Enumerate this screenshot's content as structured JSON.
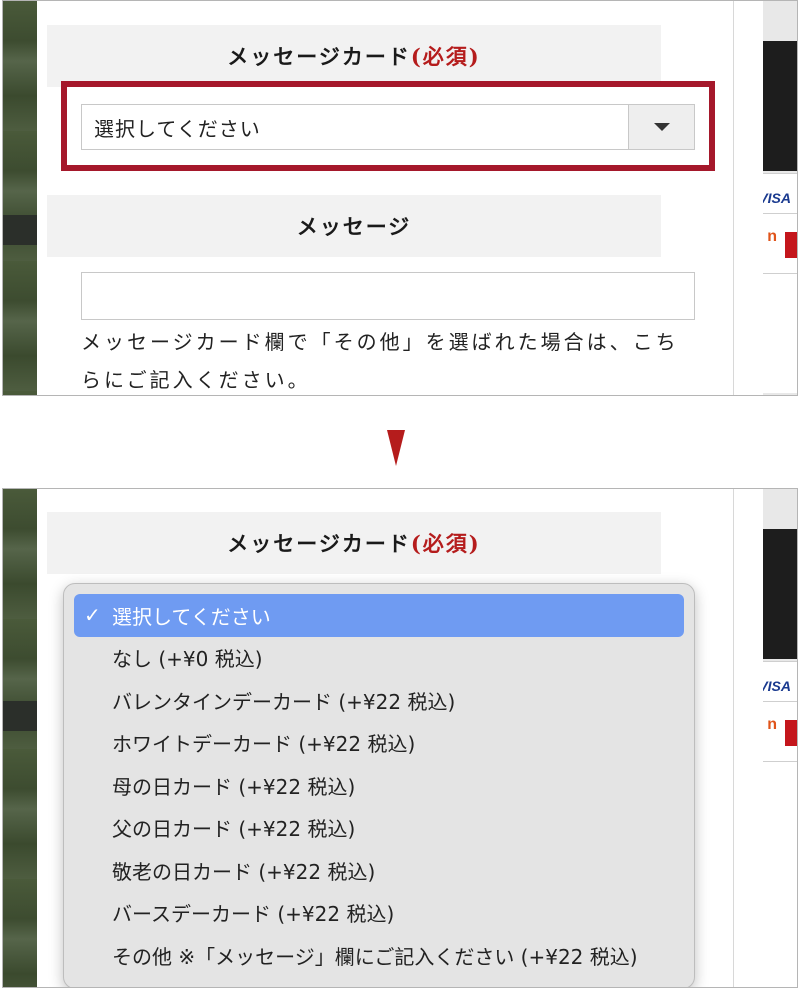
{
  "top_panel": {
    "message_card_section": {
      "title": "メッセージカード",
      "required_label": "(必須)"
    },
    "card_select": {
      "value": "選択してください"
    },
    "message_section": {
      "title": "メッセージ"
    },
    "message_input": {
      "value": ""
    },
    "note": "メッセージカード欄で「その他」を選ばれた場合は、こちらにご記入ください。"
  },
  "bottom_panel": {
    "message_card_section": {
      "title": "メッセージカード",
      "required_label": "(必須)"
    },
    "dropdown": {
      "selected_index": 0,
      "options": [
        "選択してください",
        "なし (+¥0 税込)",
        "バレンタインデーカード (+¥22 税込)",
        "ホワイトデーカード (+¥22 税込)",
        "母の日カード (+¥22 税込)",
        "父の日カード (+¥22 税込)",
        "敬老の日カード (+¥22 税込)",
        "バースデーカード (+¥22 税込)",
        "その他 ※「メッセージ」欄にご記入ください (+¥22 税込)"
      ]
    }
  },
  "background": {
    "card_brand_text": "VISA"
  },
  "colors": {
    "required": "#b51c1c",
    "highlight": "#a5182b",
    "selected_option": "#6f9bf2",
    "arrow": "#b51c1c"
  },
  "icons": {
    "select_arrow": "chevron-down-icon",
    "selected_check": "checkmark-icon",
    "transition_arrow": "arrow-down-icon"
  }
}
